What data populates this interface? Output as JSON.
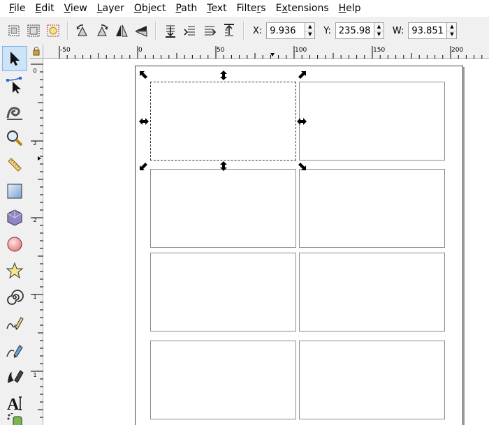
{
  "menu": [
    "File",
    "Edit",
    "View",
    "Layer",
    "Object",
    "Path",
    "Text",
    "Filters",
    "Extensions",
    "Help"
  ],
  "menu_underline": [
    "F",
    "E",
    "V",
    "L",
    "O",
    "P",
    "T",
    "r",
    "x",
    "H"
  ],
  "coords": {
    "x_label": "X:",
    "x_value": "9.936",
    "y_label": "Y:",
    "y_value": "235.983",
    "w_label": "W:",
    "w_value": "93.851"
  },
  "hruler_labels": [
    "-50",
    "0",
    "50",
    "100",
    "150",
    "200"
  ],
  "vruler_labels": [
    "0",
    "2",
    "2",
    "1",
    "1"
  ],
  "tools": [
    "selector-tool",
    "node-tool",
    "tweak-tool",
    "zoom-tool",
    "measure-tool",
    "rectangle-tool",
    "3d-box-tool",
    "ellipse-tool",
    "star-tool",
    "spiral-tool",
    "pencil-tool",
    "pen-tool",
    "calligraphy-tool",
    "text-tool",
    "spray-tool"
  ],
  "colors": {
    "accent": "#7eb4ea",
    "active_bg": "#cde3f8"
  }
}
